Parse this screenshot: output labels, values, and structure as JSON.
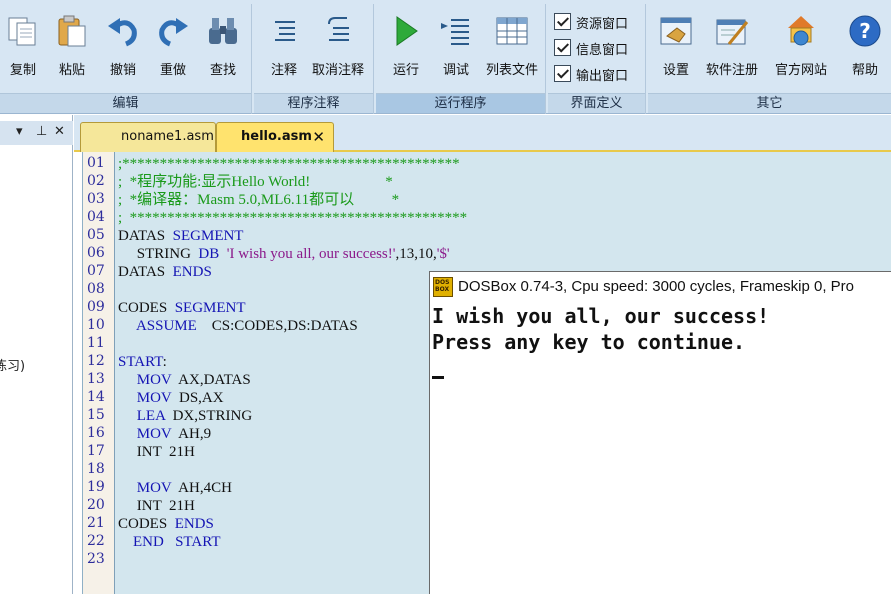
{
  "ribbon": {
    "groups": [
      {
        "title": "编辑",
        "buttons": [
          "复制",
          "粘贴",
          "撤销",
          "重做",
          "查找"
        ]
      },
      {
        "title": "程序注释",
        "buttons": [
          "注释",
          "取消注释"
        ]
      },
      {
        "title": "运行程序",
        "buttons": [
          "运行",
          "调试",
          "列表文件"
        ]
      },
      {
        "title": "界面定义",
        "checkboxes": [
          "资源窗口",
          "信息窗口",
          "输出窗口"
        ]
      },
      {
        "title": "其它",
        "buttons": [
          "设置",
          "软件注册",
          "官方网站",
          "帮助"
        ]
      }
    ]
  },
  "dock": {
    "pin": "⊥",
    "close": "✕",
    "partial_text": "练习)"
  },
  "tabs": [
    {
      "label": "noname1.asm",
      "active": false
    },
    {
      "label": "hello.asm",
      "active": true,
      "close": "✕"
    }
  ],
  "editor": {
    "line_numbers": [
      "01",
      "02",
      "03",
      "04",
      "05",
      "06",
      "07",
      "08",
      "09",
      "10",
      "11",
      "12",
      "13",
      "14",
      "15",
      "16",
      "17",
      "18",
      "19",
      "20",
      "21",
      "22",
      "23"
    ],
    "lines": [
      [
        {
          "t": ";*********************************************",
          "c": "com"
        }
      ],
      [
        {
          "t": ";  *程序功能:显示Hello World!                    *",
          "c": "com"
        }
      ],
      [
        {
          "t": ";  *编译器：Masm 5.0,ML6.11都可以          *",
          "c": "com"
        }
      ],
      [
        {
          "t": ";  *********************************************",
          "c": "com"
        }
      ],
      [
        {
          "t": "DATAS  ",
          "c": "txt"
        },
        {
          "t": "SEGMENT",
          "c": "kw"
        }
      ],
      [
        {
          "t": "     STRING  ",
          "c": "txt"
        },
        {
          "t": "DB",
          "c": "kw"
        },
        {
          "t": "  ",
          "c": "txt"
        },
        {
          "t": "'I wish you all, our success!'",
          "c": "str"
        },
        {
          "t": ",13,10,",
          "c": "txt"
        },
        {
          "t": "'$'",
          "c": "str"
        }
      ],
      [
        {
          "t": "DATAS  ",
          "c": "txt"
        },
        {
          "t": "ENDS",
          "c": "kw"
        }
      ],
      [],
      [
        {
          "t": "CODES  ",
          "c": "txt"
        },
        {
          "t": "SEGMENT",
          "c": "kw"
        }
      ],
      [
        {
          "t": "     ",
          "c": "txt"
        },
        {
          "t": "ASSUME",
          "c": "kw"
        },
        {
          "t": "    CS:CODES,DS:DATAS",
          "c": "txt"
        }
      ],
      [],
      [
        {
          "t": "START",
          "c": "kw"
        },
        {
          "t": ":",
          "c": "txt"
        }
      ],
      [
        {
          "t": "     ",
          "c": "txt"
        },
        {
          "t": "MOV",
          "c": "kw"
        },
        {
          "t": "  AX,DATAS",
          "c": "txt"
        }
      ],
      [
        {
          "t": "     ",
          "c": "txt"
        },
        {
          "t": "MOV",
          "c": "kw"
        },
        {
          "t": "  DS,AX",
          "c": "txt"
        }
      ],
      [
        {
          "t": "     ",
          "c": "txt"
        },
        {
          "t": "LEA",
          "c": "kw"
        },
        {
          "t": "  DX,STRING",
          "c": "txt"
        }
      ],
      [
        {
          "t": "     ",
          "c": "txt"
        },
        {
          "t": "MOV",
          "c": "kw"
        },
        {
          "t": "  AH,9",
          "c": "txt"
        }
      ],
      [
        {
          "t": "     INT  21H",
          "c": "txt"
        }
      ],
      [],
      [
        {
          "t": "     ",
          "c": "txt"
        },
        {
          "t": "MOV",
          "c": "kw"
        },
        {
          "t": "  AH,4CH",
          "c": "txt"
        }
      ],
      [
        {
          "t": "     INT  21H",
          "c": "txt"
        }
      ],
      [
        {
          "t": "CODES  ",
          "c": "txt"
        },
        {
          "t": "ENDS",
          "c": "kw"
        }
      ],
      [
        {
          "t": "    ",
          "c": "txt"
        },
        {
          "t": "END",
          "c": "kw"
        },
        {
          "t": "   ",
          "c": "txt"
        },
        {
          "t": "START",
          "c": "kw"
        }
      ],
      []
    ]
  },
  "dosbox": {
    "logo": "DOS BOX",
    "title": "DOSBox 0.74-3, Cpu speed:     3000 cycles, Frameskip  0, Pro",
    "output": [
      "I wish you all, our success!",
      "Press any key to continue."
    ]
  },
  "colors": {
    "ribbon_bg": "#d7e6f3",
    "editor_bg": "#d3e6ee",
    "comment": "#1a9a1a",
    "keyword": "#1414b4",
    "string": "#8b1a8b",
    "tab_active": "#ffe36e"
  }
}
